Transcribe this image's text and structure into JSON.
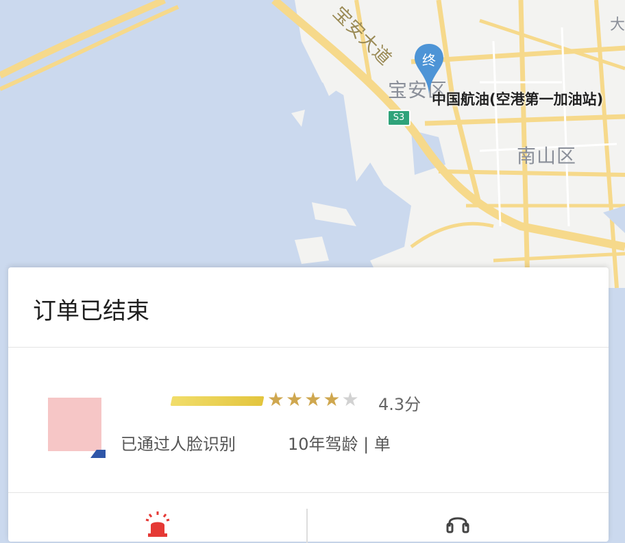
{
  "map": {
    "labels": {
      "baoan_district": "宝安区",
      "nanshan_district": "南山区",
      "road_name": "宝安大道",
      "partial_label": "大"
    },
    "route_shield": "S3",
    "end_marker_label": "终",
    "poi_name": "中国航油(空港第一加油站)",
    "colors": {
      "water": "#cbd9ee",
      "land": "#f3f3f1",
      "road": "#f6d98b",
      "marker": "#4d94d6"
    }
  },
  "order": {
    "status_title": "订单已结束",
    "driver": {
      "rating_stars": 4,
      "rating_max": 5,
      "rating_text": "4.3分",
      "face_verified_text": "已通过人脸识别",
      "driving_years_text": "10年驾龄 | 单"
    },
    "actions": {
      "left_icon": "alarm-siren-icon",
      "right_icon": "headset-service-icon"
    }
  }
}
